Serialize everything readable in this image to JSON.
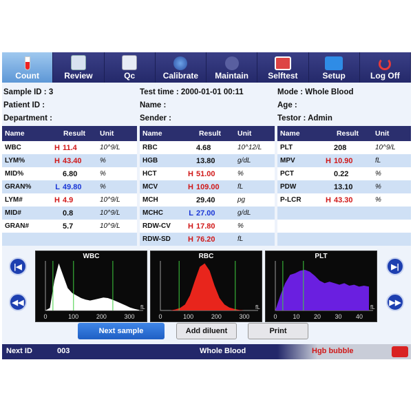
{
  "toolbar": {
    "items": [
      {
        "label": "Count",
        "icon": "test-tube-icon",
        "active": true
      },
      {
        "label": "Review",
        "icon": "calendar-icon"
      },
      {
        "label": "Qc",
        "icon": "chart-icon"
      },
      {
        "label": "Calibrate",
        "icon": "calibrate-icon"
      },
      {
        "label": "Maintain",
        "icon": "maintain-icon"
      },
      {
        "label": "Selftest",
        "icon": "selftest-icon"
      },
      {
        "label": "Setup",
        "icon": "folder-icon"
      },
      {
        "label": "Log Off",
        "icon": "power-icon"
      }
    ]
  },
  "info": {
    "sample_id": "Sample ID : 3",
    "patient_id": "Patient ID :",
    "department": "Department :",
    "test_time": "Test time : 2000-01-01 00:11",
    "name": "Name :",
    "sender": "Sender :",
    "mode": "Mode : Whole Blood",
    "age": "Age :",
    "testor": "Testor : Admin"
  },
  "table_headers": {
    "name": "Name",
    "result": "Result",
    "unit": "Unit"
  },
  "table_wbc": [
    {
      "name": "WBC",
      "flag": "H",
      "value": "11.4",
      "unit": "10^9/L"
    },
    {
      "name": "LYM%",
      "flag": "H",
      "value": "43.40",
      "unit": "%"
    },
    {
      "name": "MID%",
      "flag": "",
      "value": "6.80",
      "unit": "%"
    },
    {
      "name": "GRAN%",
      "flag": "L",
      "value": "49.80",
      "unit": "%"
    },
    {
      "name": "LYM#",
      "flag": "H",
      "value": "4.9",
      "unit": "10^9/L"
    },
    {
      "name": "MID#",
      "flag": "",
      "value": "0.8",
      "unit": "10^9/L"
    },
    {
      "name": "GRAN#",
      "flag": "",
      "value": "5.7",
      "unit": "10^9/L"
    },
    {
      "name": "",
      "flag": "",
      "value": "",
      "unit": ""
    }
  ],
  "table_rbc": [
    {
      "name": "RBC",
      "flag": "",
      "value": "4.68",
      "unit": "10^12/L"
    },
    {
      "name": "HGB",
      "flag": "",
      "value": "13.80",
      "unit": "g/dL"
    },
    {
      "name": "HCT",
      "flag": "H",
      "value": "51.00",
      "unit": "%"
    },
    {
      "name": "MCV",
      "flag": "H",
      "value": "109.00",
      "unit": "fL"
    },
    {
      "name": "MCH",
      "flag": "",
      "value": "29.40",
      "unit": "pg"
    },
    {
      "name": "MCHC",
      "flag": "L",
      "value": "27.00",
      "unit": "g/dL"
    },
    {
      "name": "RDW-CV",
      "flag": "H",
      "value": "17.80",
      "unit": "%"
    },
    {
      "name": "RDW-SD",
      "flag": "H",
      "value": "76.20",
      "unit": "fL"
    }
  ],
  "table_plt": [
    {
      "name": "PLT",
      "flag": "",
      "value": "208",
      "unit": "10^9/L"
    },
    {
      "name": "MPV",
      "flag": "H",
      "value": "10.90",
      "unit": "fL"
    },
    {
      "name": "PCT",
      "flag": "",
      "value": "0.22",
      "unit": "%"
    },
    {
      "name": "PDW",
      "flag": "",
      "value": "13.10",
      "unit": "%"
    },
    {
      "name": "P-LCR",
      "flag": "H",
      "value": "43.30",
      "unit": "%"
    },
    {
      "name": "",
      "flag": "",
      "value": "",
      "unit": ""
    },
    {
      "name": "",
      "flag": "",
      "value": "",
      "unit": ""
    },
    {
      "name": "",
      "flag": "",
      "value": "",
      "unit": ""
    }
  ],
  "histograms": {
    "wbc": {
      "title": "WBC",
      "ticks": [
        "0",
        "100",
        "200",
        "300"
      ],
      "unit": "fL",
      "color": "#ffffff"
    },
    "rbc": {
      "title": "RBC",
      "ticks": [
        "0",
        "100",
        "200",
        "300"
      ],
      "unit": "fL",
      "color": "#e8251c"
    },
    "plt": {
      "title": "PLT",
      "ticks": [
        "0",
        "10",
        "20",
        "30",
        "40"
      ],
      "unit": "fL",
      "color": "#6a1fe0"
    }
  },
  "buttons": {
    "next_sample": "Next sample",
    "add_diluent": "Add diluent",
    "print": "Print"
  },
  "status": {
    "next_id_label": "Next ID",
    "next_id": "003",
    "mode": "Whole Blood",
    "alarm": "Hgb bubble"
  },
  "colors": {
    "high": "#d01818",
    "low": "#1a36d6",
    "header": "#2b2f6e",
    "accent": "#2e6fd8"
  }
}
